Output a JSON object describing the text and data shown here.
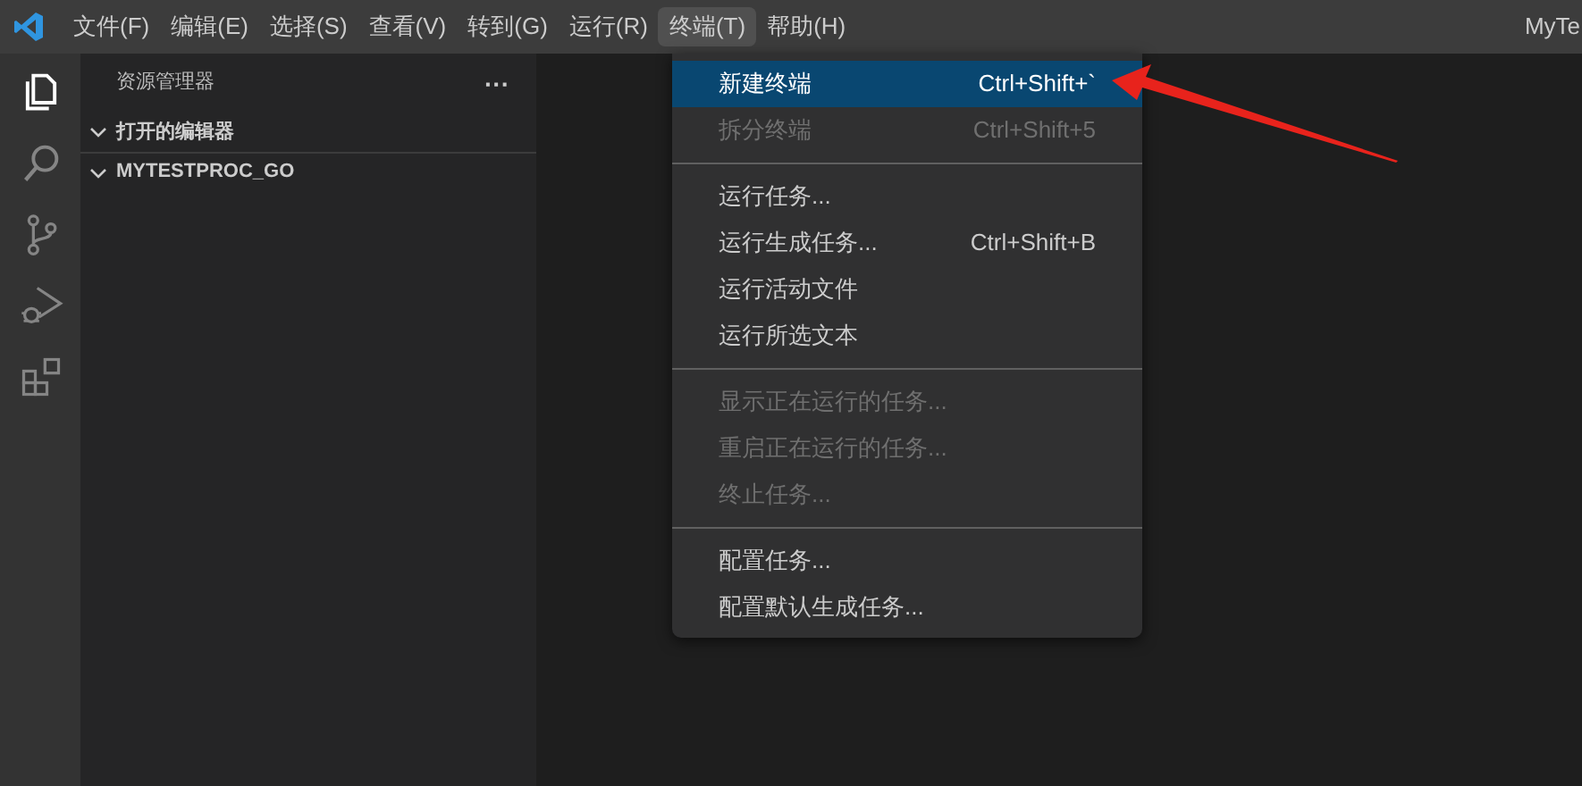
{
  "menubar": [
    {
      "label": "文件(F)",
      "selected": false
    },
    {
      "label": "编辑(E)",
      "selected": false
    },
    {
      "label": "选择(S)",
      "selected": false
    },
    {
      "label": "查看(V)",
      "selected": false
    },
    {
      "label": "转到(G)",
      "selected": false
    },
    {
      "label": "运行(R)",
      "selected": false
    },
    {
      "label": "终端(T)",
      "selected": true
    },
    {
      "label": "帮助(H)",
      "selected": false
    }
  ],
  "window": {
    "title": "MyTe"
  },
  "activity_bar": [
    {
      "kind": "files",
      "selected": true
    },
    {
      "kind": "search",
      "selected": false
    },
    {
      "kind": "source-control",
      "selected": false
    },
    {
      "kind": "debug",
      "selected": false
    },
    {
      "kind": "extensions",
      "selected": false
    }
  ],
  "sidebar": {
    "title": "资源管理器",
    "more": "···",
    "sections": [
      {
        "label": "打开的编辑器",
        "expanded": true
      },
      {
        "label": "MYTESTPROC_GO",
        "expanded": true
      }
    ]
  },
  "menu": [
    {
      "kind": "item",
      "label": "新建终端",
      "shortcut": "Ctrl+Shift+`",
      "selected": true,
      "disabled": false
    },
    {
      "kind": "item",
      "label": "拆分终端",
      "shortcut": "Ctrl+Shift+5",
      "selected": false,
      "disabled": true
    },
    {
      "kind": "separator"
    },
    {
      "kind": "item",
      "label": "运行任务...",
      "selected": false,
      "disabled": false
    },
    {
      "kind": "item",
      "label": "运行生成任务...",
      "shortcut": "Ctrl+Shift+B",
      "selected": false,
      "disabled": false
    },
    {
      "kind": "item",
      "label": "运行活动文件",
      "selected": false,
      "disabled": false
    },
    {
      "kind": "item",
      "label": "运行所选文本",
      "selected": false,
      "disabled": false
    },
    {
      "kind": "separator"
    },
    {
      "kind": "item",
      "label": "显示正在运行的任务...",
      "selected": false,
      "disabled": true
    },
    {
      "kind": "item",
      "label": "重启正在运行的任务...",
      "selected": false,
      "disabled": true
    },
    {
      "kind": "item",
      "label": "终止任务...",
      "selected": false,
      "disabled": true
    },
    {
      "kind": "separator"
    },
    {
      "kind": "item",
      "label": "配置任务...",
      "selected": false,
      "disabled": false
    },
    {
      "kind": "item",
      "label": "配置默认生成任务...",
      "selected": false,
      "disabled": false
    }
  ]
}
